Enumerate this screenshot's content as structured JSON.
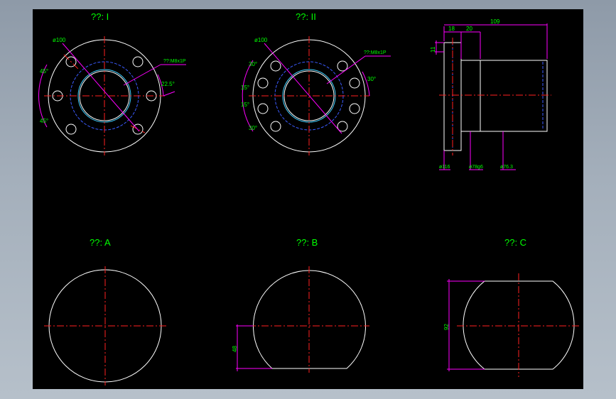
{
  "drawing": {
    "view1": {
      "title": "??: I",
      "dia_outer": "ø100",
      "thread": "??:M8x1P",
      "angle_a": "45°",
      "angle_b": "45°",
      "angle_c": "22.5°"
    },
    "view2": {
      "title": "??: II",
      "dia_outer": "ø100",
      "thread": "??:M8x1P",
      "a30_1": "30°",
      "a15_1": "15°",
      "a15_2": "15°",
      "a30_2": "30°",
      "a30_r": "30°"
    },
    "view3": {
      "dim_18": "18",
      "dim_20": "20",
      "dim_109": "109",
      "dim_11": "11",
      "dia_116": "ø116",
      "dia_78": "ø78g6",
      "dia_76": "ø76.3"
    },
    "viewA": {
      "title": "??: A"
    },
    "viewB": {
      "title": "??: B",
      "dim_48": "48"
    },
    "viewC": {
      "title": "??: C",
      "dim_92": "92"
    }
  },
  "colors": {
    "background": "#000000",
    "frame": "#a4afbb",
    "outline": "#ffffff",
    "center_line": "#ff2020",
    "hidden_line": "#3b5bff",
    "dimension": "#ff00ff",
    "text": "#00ff00"
  }
}
